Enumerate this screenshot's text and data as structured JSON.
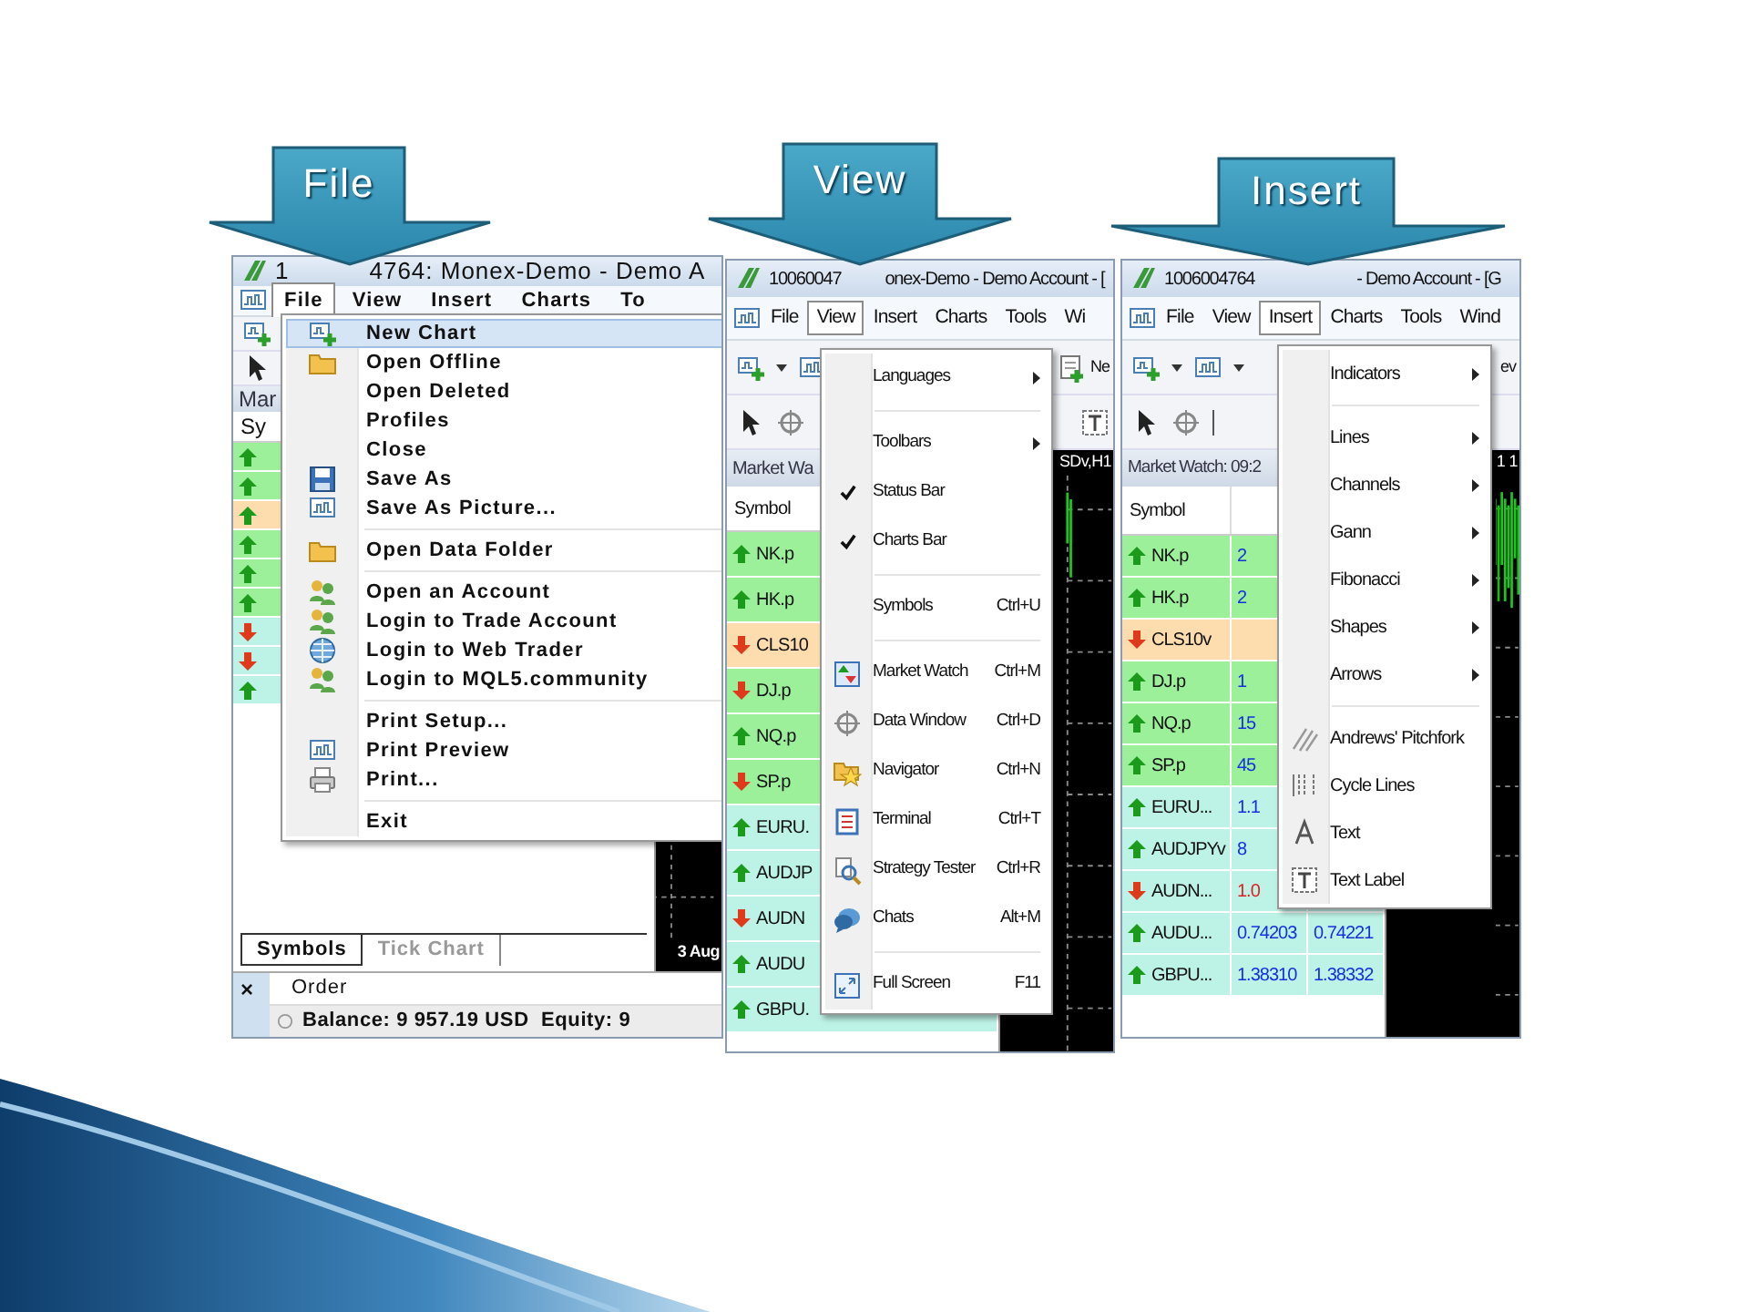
{
  "callouts": [
    {
      "label": "File"
    },
    {
      "label": "View"
    },
    {
      "label": "Insert"
    }
  ],
  "panels": [
    {
      "title_fragments": [
        "1",
        "4764: Monex-Demo - Demo A"
      ],
      "menu_bar": [
        {
          "label": "File",
          "selected": true
        },
        {
          "label": "View",
          "selected": false
        },
        {
          "label": "Insert",
          "selected": false
        },
        {
          "label": "Charts",
          "selected": false
        },
        {
          "label": "To",
          "selected": false
        }
      ],
      "market_watch": {
        "title": "Mar",
        "column_headers": [
          "Sy"
        ],
        "rows": [
          {
            "up": true,
            "color": "#9cf09a"
          },
          {
            "up": true,
            "color": "#9cf09a"
          },
          {
            "up": true,
            "color": "#fddcae"
          },
          {
            "up": true,
            "color": "#9cf09a"
          },
          {
            "up": true,
            "color": "#9cf09a"
          },
          {
            "up": true,
            "color": "#9cf09a"
          },
          {
            "up": false,
            "color": "#bdf3e6"
          },
          {
            "up": false,
            "color": "#bdf3e6"
          },
          {
            "up": true,
            "color": "#bdf3e6"
          }
        ]
      },
      "chart": {
        "kind": "date_axis",
        "caption": "3 Aug"
      },
      "tabs": [
        {
          "label": "Symbols",
          "selected": true
        },
        {
          "label": "Tick Chart",
          "selected": false
        }
      ],
      "terminal": {
        "close": "×",
        "column": "Order",
        "balance": "Balance: 9 957.19 USD  Equity: 9"
      },
      "menu": [
        {
          "kind": "item",
          "label": "New Chart",
          "selected": true
        },
        {
          "kind": "item",
          "label": "Open Offline",
          "selected": false
        },
        {
          "kind": "item",
          "label": "Open Deleted",
          "selected": false
        },
        {
          "kind": "item",
          "label": "Profiles",
          "selected": false
        },
        {
          "kind": "item",
          "label": "Close",
          "selected": false
        },
        {
          "kind": "item",
          "label": "Save As",
          "selected": false
        },
        {
          "kind": "item",
          "label": "Save As Picture...",
          "selected": false
        },
        {
          "kind": "separator"
        },
        {
          "kind": "item",
          "label": "Open Data Folder",
          "selected": false
        },
        {
          "kind": "separator"
        },
        {
          "kind": "item",
          "label": "Open an Account",
          "selected": false
        },
        {
          "kind": "item",
          "label": "Login to Trade Account",
          "selected": false
        },
        {
          "kind": "item",
          "label": "Login to Web Trader",
          "selected": false
        },
        {
          "kind": "item",
          "label": "Login to MQL5.community",
          "selected": false
        },
        {
          "kind": "separator"
        },
        {
          "kind": "item",
          "label": "Print Setup...",
          "selected": false
        },
        {
          "kind": "item",
          "label": "Print Preview",
          "selected": false
        },
        {
          "kind": "item",
          "label": "Print...",
          "selected": false
        },
        {
          "kind": "separator"
        },
        {
          "kind": "item",
          "label": "Exit",
          "selected": false
        }
      ]
    },
    {
      "title_fragments": [
        "10060047",
        "onex-Demo - Demo Account - ["
      ],
      "menu_bar": [
        {
          "label": "File",
          "selected": false
        },
        {
          "label": "View",
          "selected": true
        },
        {
          "label": "Insert",
          "selected": false
        },
        {
          "label": "Charts",
          "selected": false
        },
        {
          "label": "Tools",
          "selected": false
        },
        {
          "label": "Wi",
          "selected": false
        }
      ],
      "toolbar_text": "Ne",
      "market_watch": {
        "title": "Market Wa",
        "column_headers": [
          "Symbol"
        ],
        "rows": [
          {
            "symbol": "NK.p",
            "up": true,
            "color": "#9cf09a"
          },
          {
            "symbol": "HK.p",
            "up": true,
            "color": "#9cf09a"
          },
          {
            "symbol": "CLS10",
            "up": false,
            "color": "#fddcae"
          },
          {
            "symbol": "DJ.p",
            "up": false,
            "color": "#9cf09a"
          },
          {
            "symbol": "NQ.p",
            "up": true,
            "color": "#9cf09a"
          },
          {
            "symbol": "SP.p",
            "up": false,
            "color": "#9cf09a"
          },
          {
            "symbol": "EURU.",
            "up": true,
            "color": "#bdf3e6"
          },
          {
            "symbol": "AUDJP",
            "up": true,
            "color": "#bdf3e6"
          },
          {
            "symbol": "AUDN",
            "up": false,
            "color": "#bdf3e6"
          },
          {
            "symbol": "AUDU",
            "up": true,
            "color": "#bdf3e6"
          },
          {
            "symbol": "GBPU.",
            "up": true,
            "color": "#bdf3e6"
          }
        ]
      },
      "chart": {
        "kind": "title",
        "caption": "SDv,H1"
      },
      "menu": [
        {
          "kind": "item",
          "label": "Languages",
          "selected": false,
          "checked": false,
          "submenu": true
        },
        {
          "kind": "separator"
        },
        {
          "kind": "item",
          "label": "Toolbars",
          "selected": false,
          "checked": false,
          "submenu": true
        },
        {
          "kind": "item",
          "label": "Status Bar",
          "selected": false,
          "checked": true,
          "submenu": false
        },
        {
          "kind": "item",
          "label": "Charts Bar",
          "selected": false,
          "checked": true,
          "submenu": false
        },
        {
          "kind": "separator"
        },
        {
          "kind": "item",
          "label": "Symbols",
          "shortcut": "Ctrl+U",
          "selected": false,
          "checked": false,
          "submenu": false
        },
        {
          "kind": "separator"
        },
        {
          "kind": "item",
          "label": "Market Watch",
          "shortcut": "Ctrl+M",
          "selected": false,
          "checked": false,
          "submenu": false
        },
        {
          "kind": "item",
          "label": "Data Window",
          "shortcut": "Ctrl+D",
          "selected": false,
          "checked": false,
          "submenu": false
        },
        {
          "kind": "item",
          "label": "Navigator",
          "shortcut": "Ctrl+N",
          "selected": false,
          "checked": false,
          "submenu": false
        },
        {
          "kind": "item",
          "label": "Terminal",
          "shortcut": "Ctrl+T",
          "selected": false,
          "checked": false,
          "submenu": false
        },
        {
          "kind": "item",
          "label": "Strategy Tester",
          "shortcut": "Ctrl+R",
          "selected": false,
          "checked": false,
          "submenu": false
        },
        {
          "kind": "item",
          "label": "Chats",
          "shortcut": "Alt+M",
          "selected": false,
          "checked": false,
          "submenu": false
        },
        {
          "kind": "separator"
        },
        {
          "kind": "item",
          "label": "Full Screen",
          "shortcut": "F11",
          "selected": false,
          "checked": false,
          "submenu": false
        }
      ]
    },
    {
      "title_fragments": [
        "1006004764",
        "- Demo Account - [G"
      ],
      "menu_bar": [
        {
          "label": "File",
          "selected": false
        },
        {
          "label": "View",
          "selected": false
        },
        {
          "label": "Insert",
          "selected": true
        },
        {
          "label": "Charts",
          "selected": false
        },
        {
          "label": "Tools",
          "selected": false
        },
        {
          "label": "Wind",
          "selected": false
        }
      ],
      "toolbar_text": "ev",
      "market_watch": {
        "title": "Market Watch: 09:2",
        "column_headers": [
          "Symbol"
        ],
        "rows": [
          {
            "symbol": "NK.p",
            "up": true,
            "color": "#9cf09a",
            "values": [
              "2"
            ]
          },
          {
            "symbol": "HK.p",
            "up": true,
            "color": "#9cf09a",
            "values": [
              "2"
            ]
          },
          {
            "symbol": "CLS10v",
            "up": false,
            "color": "#fddcae"
          },
          {
            "symbol": "DJ.p",
            "up": true,
            "color": "#9cf09a",
            "values": [
              "1"
            ]
          },
          {
            "symbol": "NQ.p",
            "up": true,
            "color": "#9cf09a",
            "values": [
              "15"
            ]
          },
          {
            "symbol": "SP.p",
            "up": true,
            "color": "#9cf09a",
            "values": [
              "45"
            ]
          },
          {
            "symbol": "EURU...",
            "up": true,
            "color": "#bdf3e6",
            "values": [
              "1.1"
            ]
          },
          {
            "symbol": "AUDJPYv",
            "up": true,
            "color": "#bdf3e6",
            "values": [
              "8"
            ]
          },
          {
            "symbol": "AUDN...",
            "up": false,
            "color": "#bdf3e6",
            "values": [
              "1.0"
            ]
          },
          {
            "symbol": "AUDU...",
            "up": true,
            "color": "#bdf3e6",
            "values": [
              "0.74203",
              "0.74221"
            ]
          },
          {
            "symbol": "GBPU...",
            "up": true,
            "color": "#bdf3e6",
            "values": [
              "1.38310",
              "1.38332"
            ]
          }
        ]
      },
      "chart": {
        "kind": "title",
        "caption": "1 1"
      },
      "menu": [
        {
          "kind": "item",
          "label": "Indicators",
          "selected": false,
          "submenu": true
        },
        {
          "kind": "separator"
        },
        {
          "kind": "item",
          "label": "Lines",
          "selected": false,
          "submenu": true
        },
        {
          "kind": "item",
          "label": "Channels",
          "selected": false,
          "submenu": true
        },
        {
          "kind": "item",
          "label": "Gann",
          "selected": false,
          "submenu": true
        },
        {
          "kind": "item",
          "label": "Fibonacci",
          "selected": false,
          "submenu": true
        },
        {
          "kind": "item",
          "label": "Shapes",
          "selected": false,
          "submenu": true
        },
        {
          "kind": "item",
          "label": "Arrows",
          "selected": false,
          "submenu": true
        },
        {
          "kind": "separator"
        },
        {
          "kind": "item",
          "label": "Andrews' Pitchfork",
          "selected": false,
          "submenu": false
        },
        {
          "kind": "item",
          "label": "Cycle Lines",
          "selected": false,
          "submenu": false
        },
        {
          "kind": "item",
          "label": "Text",
          "selected": false,
          "submenu": false
        },
        {
          "kind": "item",
          "label": "Text Label",
          "selected": false,
          "submenu": false
        }
      ]
    }
  ]
}
